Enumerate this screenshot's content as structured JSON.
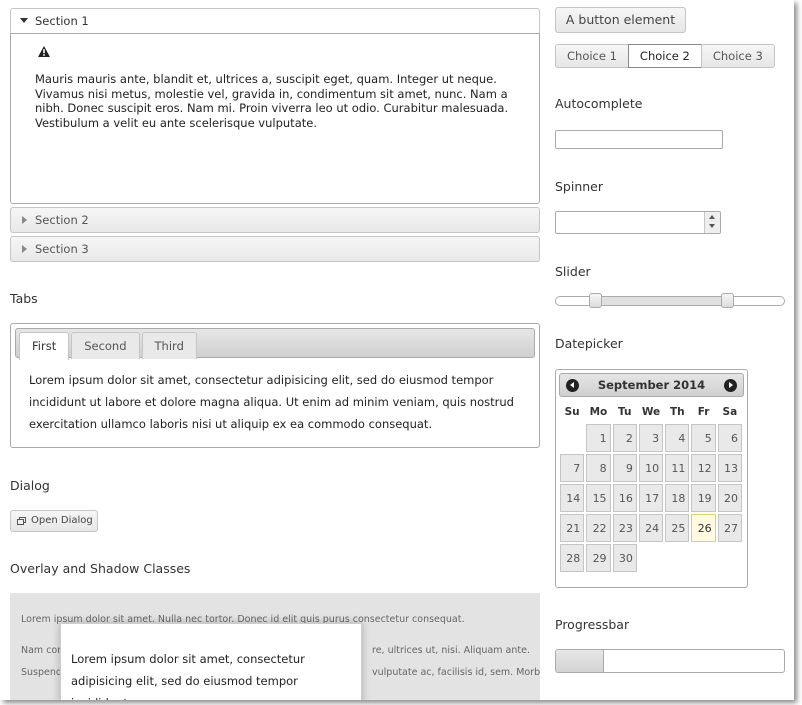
{
  "accordion": {
    "sections": [
      {
        "label": "Section 1",
        "expanded": true
      },
      {
        "label": "Section 2",
        "expanded": false
      },
      {
        "label": "Section 3",
        "expanded": false
      }
    ],
    "content": "Mauris mauris ante, blandit et, ultrices a, suscipit eget, quam. Integer ut neque. Vivamus nisi metus, molestie vel, gravida in, condimentum sit amet, nunc. Nam a nibh. Donec suscipit eros. Nam mi. Proin viverra leo ut odio. Curabitur malesuada. Vestibulum a velit eu ante scelerisque vulputate.",
    "icon": "alert-icon"
  },
  "tabs": {
    "heading": "Tabs",
    "items": [
      {
        "label": "First"
      },
      {
        "label": "Second"
      },
      {
        "label": "Third"
      }
    ],
    "active": "First",
    "content": "Lorem ipsum dolor sit amet, consectetur adipisicing elit, sed do eiusmod tempor incididunt ut labore et dolore magna aliqua. Ut enim ad minim veniam, quis nostrud exercitation ullamco laboris nisi ut aliquip ex ea commodo consequat."
  },
  "dialog": {
    "heading": "Dialog",
    "button_label": "Open Dialog",
    "icon": "new-window-icon"
  },
  "overlay": {
    "heading": "Overlay and Shadow Classes",
    "line1": "Lorem ipsum dolor sit amet. Nulla nec tortor. Donec id elit quis purus consectetur consequat.",
    "line2_left": "Nam con",
    "line2_right": "re, ultrices ut, nisi. Aliquam ante.",
    "line3_left": "Suspend",
    "line3_right": "vulputate ac, facilisis id, sem. Morbi",
    "dialog_text": "Lorem ipsum dolor sit amet, consectetur adipisicing elit, sed do eiusmod tempor incididunt"
  },
  "button_element": {
    "label": "A button element"
  },
  "choices": {
    "items": [
      "Choice 1",
      "Choice 2",
      "Choice 3"
    ],
    "selected": "Choice 2"
  },
  "autocomplete": {
    "heading": "Autocomplete",
    "value": ""
  },
  "spinner": {
    "heading": "Spinner",
    "value": ""
  },
  "slider": {
    "heading": "Slider",
    "range": [
      17,
      75
    ]
  },
  "datepicker": {
    "heading": "Datepicker",
    "month_label": "September 2014",
    "weekdays": [
      "Su",
      "Mo",
      "Tu",
      "We",
      "Th",
      "Fr",
      "Sa"
    ],
    "first_weekday_index": 1,
    "days_in_month": 30,
    "today": 26,
    "icons": {
      "prev": "prev-circle-icon",
      "next": "next-circle-icon"
    }
  },
  "progressbar": {
    "heading": "Progressbar",
    "value": 0.21
  },
  "colors": {
    "accent_gray": "#c5c5c5",
    "today_highlight": "#fffae0"
  }
}
